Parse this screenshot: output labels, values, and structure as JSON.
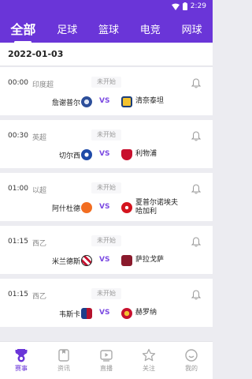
{
  "status_bar": {
    "time": "2:29"
  },
  "top_tabs": [
    "全部",
    "足球",
    "篮球",
    "电竞",
    "网球"
  ],
  "date": "2022-01-03",
  "matches": [
    {
      "time": "00:00",
      "league": "印度超",
      "status": "未开始",
      "home": "詹谢普尔",
      "away": "清奈泰坦",
      "vs": "VS"
    },
    {
      "time": "00:30",
      "league": "英超",
      "status": "未开始",
      "home": "切尔西",
      "away": "利物浦",
      "vs": "VS"
    },
    {
      "time": "01:00",
      "league": "以超",
      "status": "未开始",
      "home": "阿什杜德",
      "away": "夏普尔诺埃夫哈加利",
      "vs": "VS"
    },
    {
      "time": "01:15",
      "league": "西乙",
      "status": "未开始",
      "home": "米兰德斯",
      "away": "萨拉戈萨",
      "vs": "VS"
    },
    {
      "time": "01:15",
      "league": "西乙",
      "status": "未开始",
      "home": "韦斯卡",
      "away": "赫罗纳",
      "vs": "VS"
    }
  ],
  "bottom_nav": [
    "赛事",
    "资讯",
    "直播",
    "关注",
    "我的"
  ],
  "colors": {
    "brand": "#6a35d8",
    "vs": "#7b4ae2"
  },
  "icons": [
    "wifi-icon",
    "battery-icon",
    "bell-icon",
    "trophy-icon",
    "news-icon",
    "live-icon",
    "star-icon",
    "profile-icon"
  ]
}
